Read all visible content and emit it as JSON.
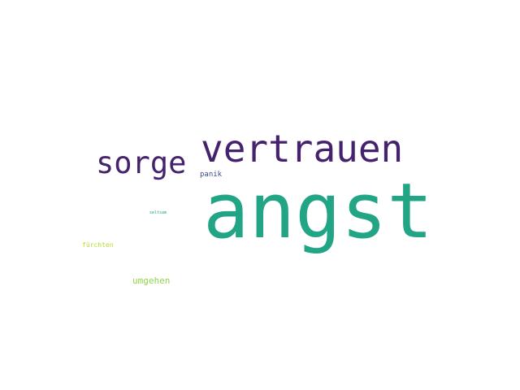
{
  "words": [
    {
      "text": "angst",
      "color": "#21a585"
    },
    {
      "text": "vertrauen",
      "color": "#45226e"
    },
    {
      "text": "sorge",
      "color": "#45226e"
    },
    {
      "text": "panik",
      "color": "#3b4b8a"
    },
    {
      "text": "seltsam",
      "color": "#21a585"
    },
    {
      "text": "fürchten",
      "color": "#b5de2b"
    },
    {
      "text": "umgehen",
      "color": "#8fd645"
    }
  ]
}
